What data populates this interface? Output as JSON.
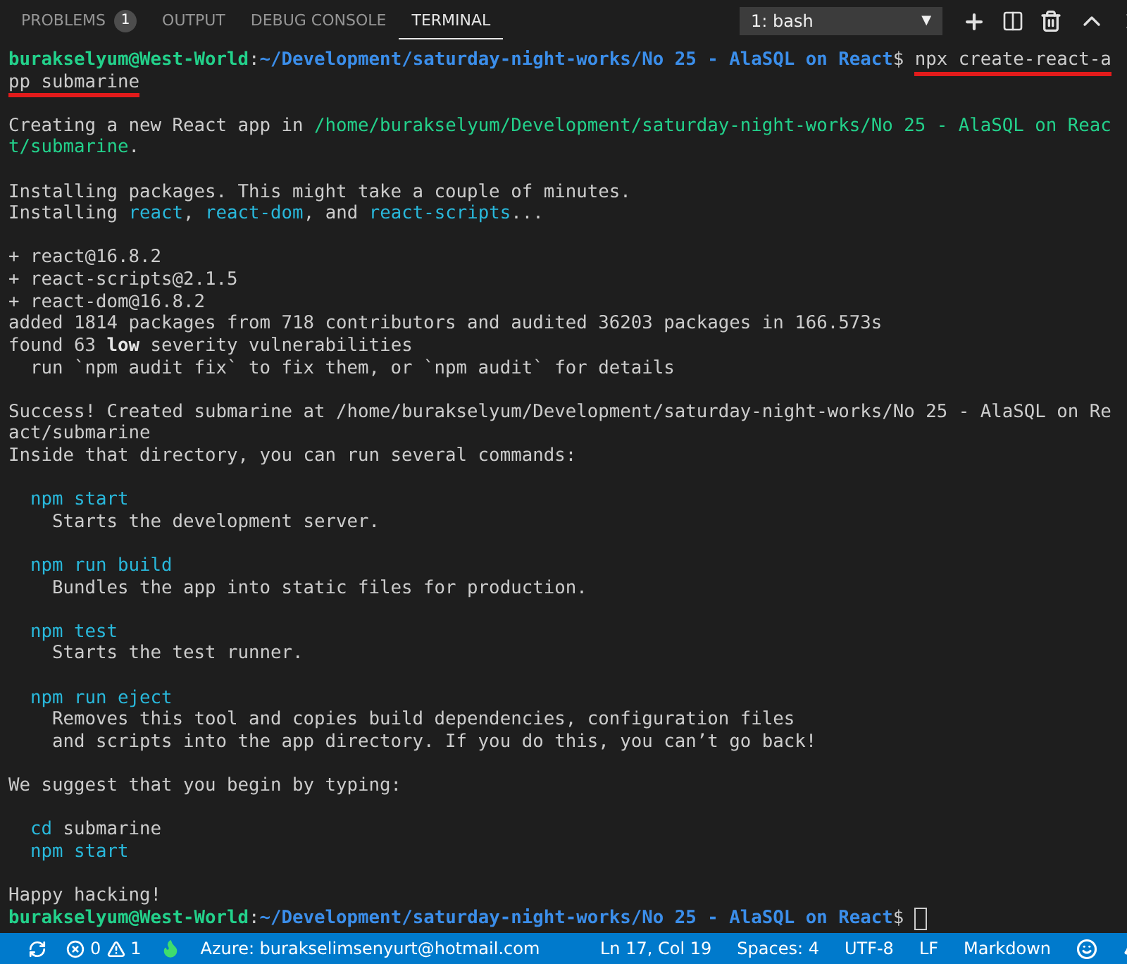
{
  "panel_tabs": [
    {
      "label": "PROBLEMS",
      "badge": "1",
      "selected": false
    },
    {
      "label": "OUTPUT",
      "selected": false
    },
    {
      "label": "DEBUG CONSOLE",
      "selected": false
    },
    {
      "label": "TERMINAL",
      "selected": true
    }
  ],
  "terminal_select": {
    "value": "1: bash",
    "caret": "▼"
  },
  "terminal": {
    "lines": [
      {
        "kind": "text",
        "segments": [
          {
            "text": "burakselyum@West-World",
            "kind": "user"
          },
          {
            "text": ":",
            "kind": "plain"
          },
          {
            "text": "~/Development/saturday-night-works/No 25 - AlaSQL on React",
            "kind": "prompt_path"
          },
          {
            "text": "$ ",
            "kind": "plain"
          },
          {
            "text": "npx create-react-a",
            "kind": "plain",
            "underlined": true
          }
        ]
      },
      {
        "kind": "text",
        "segments": [
          {
            "text": "pp submarine",
            "kind": "plain",
            "underlined": true
          }
        ]
      },
      {
        "kind": "blank"
      },
      {
        "kind": "text",
        "segments": [
          {
            "text": "Creating a new React app in ",
            "kind": "plain"
          },
          {
            "text": "/home/burakselyum/Development/saturday-night-works/No 25 - AlaSQL on Reac",
            "kind": "green"
          }
        ]
      },
      {
        "kind": "text",
        "segments": [
          {
            "text": "t/submarine",
            "kind": "green"
          },
          {
            "text": ".",
            "kind": "plain"
          }
        ]
      },
      {
        "kind": "blank"
      },
      {
        "kind": "text",
        "segments": [
          {
            "text": "Installing packages. This might take a couple of minutes.",
            "kind": "plain"
          }
        ]
      },
      {
        "kind": "text",
        "segments": [
          {
            "text": "Installing ",
            "kind": "plain"
          },
          {
            "text": "react",
            "kind": "cyan"
          },
          {
            "text": ", ",
            "kind": "plain"
          },
          {
            "text": "react-dom",
            "kind": "cyan"
          },
          {
            "text": ", and ",
            "kind": "plain"
          },
          {
            "text": "react-scripts",
            "kind": "cyan"
          },
          {
            "text": "...",
            "kind": "plain"
          }
        ]
      },
      {
        "kind": "blank"
      },
      {
        "kind": "text",
        "segments": [
          {
            "text": "+ react@16.8.2",
            "kind": "plain"
          }
        ]
      },
      {
        "kind": "text",
        "segments": [
          {
            "text": "+ react-scripts@2.1.5",
            "kind": "plain"
          }
        ]
      },
      {
        "kind": "text",
        "segments": [
          {
            "text": "+ react-dom@16.8.2",
            "kind": "plain"
          }
        ]
      },
      {
        "kind": "text",
        "segments": [
          {
            "text": "added 1814 packages from 718 contributors and audited 36203 packages in 166.573s",
            "kind": "plain"
          }
        ]
      },
      {
        "kind": "text",
        "segments": [
          {
            "text": "found 63 ",
            "kind": "plain"
          },
          {
            "text": "low",
            "kind": "bold"
          },
          {
            "text": " severity vulnerabilities",
            "kind": "plain"
          }
        ]
      },
      {
        "kind": "text",
        "segments": [
          {
            "text": "  run `npm audit fix` to fix them, or `npm audit` for details",
            "kind": "plain"
          }
        ]
      },
      {
        "kind": "blank"
      },
      {
        "kind": "text",
        "segments": [
          {
            "text": "Success! Created submarine at /home/burakselyum/Development/saturday-night-works/No 25 - AlaSQL on Re",
            "kind": "plain"
          }
        ]
      },
      {
        "kind": "text",
        "segments": [
          {
            "text": "act/submarine",
            "kind": "plain"
          }
        ]
      },
      {
        "kind": "text",
        "segments": [
          {
            "text": "Inside that directory, you can run several commands:",
            "kind": "plain"
          }
        ]
      },
      {
        "kind": "blank"
      },
      {
        "kind": "text",
        "segments": [
          {
            "text": "  npm start",
            "kind": "cyan"
          }
        ]
      },
      {
        "kind": "text",
        "segments": [
          {
            "text": "    Starts the development server.",
            "kind": "plain"
          }
        ]
      },
      {
        "kind": "blank"
      },
      {
        "kind": "text",
        "segments": [
          {
            "text": "  npm run build",
            "kind": "cyan"
          }
        ]
      },
      {
        "kind": "text",
        "segments": [
          {
            "text": "    Bundles the app into static files for production.",
            "kind": "plain"
          }
        ]
      },
      {
        "kind": "blank"
      },
      {
        "kind": "text",
        "segments": [
          {
            "text": "  npm test",
            "kind": "cyan"
          }
        ]
      },
      {
        "kind": "text",
        "segments": [
          {
            "text": "    Starts the test runner.",
            "kind": "plain"
          }
        ]
      },
      {
        "kind": "blank"
      },
      {
        "kind": "text",
        "segments": [
          {
            "text": "  npm run eject",
            "kind": "cyan"
          }
        ]
      },
      {
        "kind": "text",
        "segments": [
          {
            "text": "    Removes this tool and copies build dependencies, configuration files",
            "kind": "plain"
          }
        ]
      },
      {
        "kind": "text",
        "segments": [
          {
            "text": "    and scripts into the app directory. If you do this, you can’t go back!",
            "kind": "plain"
          }
        ]
      },
      {
        "kind": "blank"
      },
      {
        "kind": "text",
        "segments": [
          {
            "text": "We suggest that you begin by typing:",
            "kind": "plain"
          }
        ]
      },
      {
        "kind": "blank"
      },
      {
        "kind": "text",
        "segments": [
          {
            "text": "  cd",
            "kind": "cyan"
          },
          {
            "text": " submarine",
            "kind": "plain"
          }
        ]
      },
      {
        "kind": "text",
        "segments": [
          {
            "text": "  npm start",
            "kind": "cyan"
          }
        ]
      },
      {
        "kind": "blank"
      },
      {
        "kind": "text",
        "segments": [
          {
            "text": "Happy hacking!",
            "kind": "plain"
          }
        ]
      },
      {
        "kind": "prompt",
        "segments": [
          {
            "text": "burakselyum@West-World",
            "kind": "user"
          },
          {
            "text": ":",
            "kind": "plain"
          },
          {
            "text": "~/Development/saturday-night-works/No 25 - AlaSQL on React",
            "kind": "prompt_path"
          },
          {
            "text": "$ ",
            "kind": "plain"
          }
        ]
      }
    ]
  },
  "status_bar": {
    "errors": "0",
    "warnings": "1",
    "account": "Azure: burakselimsenyurt@hotmail.com",
    "position": "Ln 17, Col 19",
    "spaces": "Spaces: 4",
    "encoding": "UTF-8",
    "eol": "LF",
    "language": "Markdown"
  }
}
